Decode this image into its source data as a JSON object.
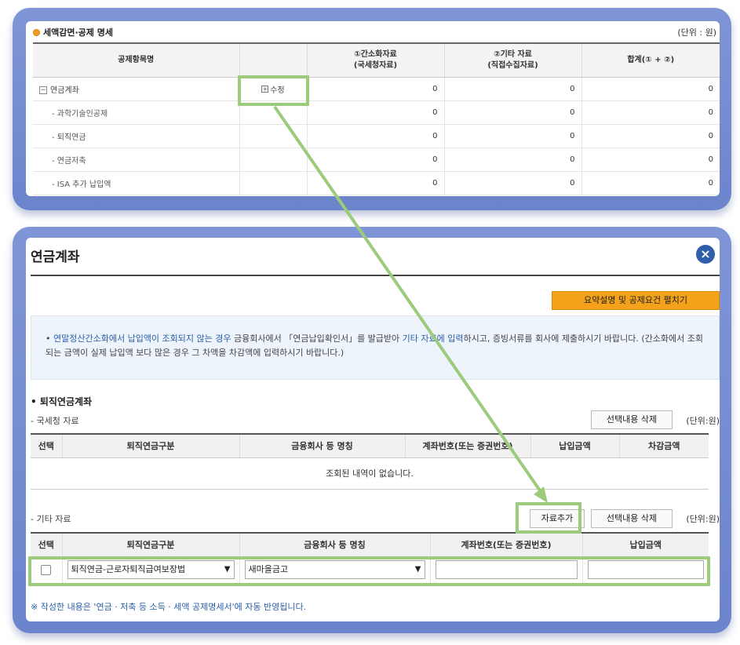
{
  "top_panel": {
    "title": "세액감면·공제 명세",
    "unit": "(단위 : 원)",
    "headers": [
      "공제항목명",
      "",
      "①간소화자료\n(국세청자료)",
      "②기타 자료\n(직접수집자료)",
      "합계(① + ②)"
    ],
    "header_1": "공제항목명",
    "header_3a": "①간소화자료",
    "header_3b": "(국세청자료)",
    "header_4a": "②기타 자료",
    "header_4b": "(직접수집자료)",
    "header_5": "합계(① + ②)",
    "edit_label": "수정",
    "rows": [
      {
        "name": "연금계좌",
        "v1": "0",
        "v2": "0",
        "v3": "0"
      },
      {
        "name": "- 과학기술인공제",
        "v1": "0",
        "v2": "0",
        "v3": "0"
      },
      {
        "name": "- 퇴직연금",
        "v1": "0",
        "v2": "0",
        "v3": "0"
      },
      {
        "name": "- 연금저축",
        "v1": "0",
        "v2": "0",
        "v3": "0"
      },
      {
        "name": "- ISA 추가 납입액",
        "v1": "0",
        "v2": "0",
        "v3": "0"
      }
    ]
  },
  "popup": {
    "title": "연금계좌",
    "close_glyph": "×",
    "summary_button": "요약설명 및 공제요건 펼치기",
    "info_p1": "• ",
    "info_hl1": "연말정산간소화에서 납입액이 조회되지 않는 경우",
    "info_p2": " 금융회사에서 「연금납입확인서」를 발급받아 ",
    "info_hl2": "기타 자료에 입력",
    "info_p3": "하시고, 증빙서류를 회사에 제출하시기 바랍니다. (간소화에서 조회되는 금액이 실제 납입액 보다 많은 경우 그 차액을 차감액에 입력하시기 바랍니다.)",
    "section_title": "• 퇴직연금계좌",
    "nts_label": "- 국세청 자료",
    "delete_button": "선택내용 삭제",
    "unit": "(단위:원)",
    "nts_headers": [
      "선택",
      "퇴직연금구분",
      "금융회사 등 명칭",
      "계좌번호(또는 증권번호)",
      "납입금액",
      "차감금액"
    ],
    "nts_empty": "조회된 내역이 없습니다.",
    "other_label": "- 기타 자료",
    "add_button": "자료추가",
    "other_headers": [
      "선택",
      "퇴직연금구분",
      "금융회사 등 명칭",
      "계좌번호(또는 증권번호)",
      "납입금액"
    ],
    "row": {
      "pension_type": "퇴직연금-근로자퇴직급여보장법",
      "institution": "새마을금고",
      "account": "",
      "amount": ""
    },
    "note": "※ 작성한 내용은 '연금 · 저축 등 소득 · 세액 공제명세서'에 자동 반영됩니다."
  },
  "colors": {
    "frame": "#7188cf",
    "highlight": "#9ccb7c",
    "accent_orange": "#f3a21a",
    "link_blue": "#2a5ea8"
  }
}
